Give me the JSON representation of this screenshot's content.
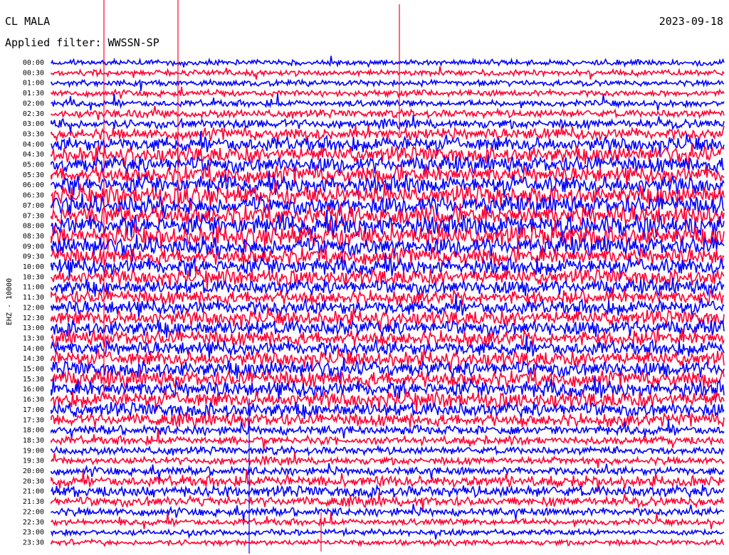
{
  "header": {
    "station": "CL MALA",
    "date": "2023-09-18",
    "filter": "Applied filter: WWSSN-SP"
  },
  "chart_data": {
    "type": "line",
    "ylabel": "EHZ - 10000",
    "colors": [
      "#0000ff",
      "#ff0033"
    ],
    "tick_labels": [
      "00:00",
      "00:30",
      "01:00",
      "01:30",
      "02:00",
      "02:30",
      "03:00",
      "03:30",
      "04:00",
      "04:30",
      "05:00",
      "05:30",
      "06:00",
      "06:30",
      "07:00",
      "07:30",
      "08:00",
      "08:30",
      "09:00",
      "09:30",
      "10:00",
      "10:30",
      "11:00",
      "11:30",
      "12:00",
      "12:30",
      "13:00",
      "13:30",
      "14:00",
      "14:30",
      "15:00",
      "15:30",
      "16:00",
      "16:30",
      "17:00",
      "17:30",
      "18:00",
      "18:30",
      "19:00",
      "19:30",
      "20:00",
      "20:30",
      "21:00",
      "21:30",
      "22:00",
      "22:30",
      "23:00",
      "23:30"
    ],
    "noise_level": [
      0.3,
      0.3,
      0.3,
      0.4,
      0.4,
      0.6,
      0.9,
      1.3,
      1.8,
      2.0,
      2.1,
      2.3,
      2.4,
      2.5,
      2.6,
      2.8,
      2.9,
      2.8,
      2.5,
      2.3,
      2.2,
      2.0,
      1.8,
      1.7,
      1.8,
      1.9,
      1.9,
      1.9,
      1.8,
      1.9,
      2.0,
      2.1,
      2.1,
      2.0,
      1.8,
      1.5,
      0.9,
      0.7,
      0.6,
      0.6,
      0.7,
      1.1,
      1.2,
      1.0,
      0.7,
      0.4,
      0.3,
      0.3
    ]
  }
}
